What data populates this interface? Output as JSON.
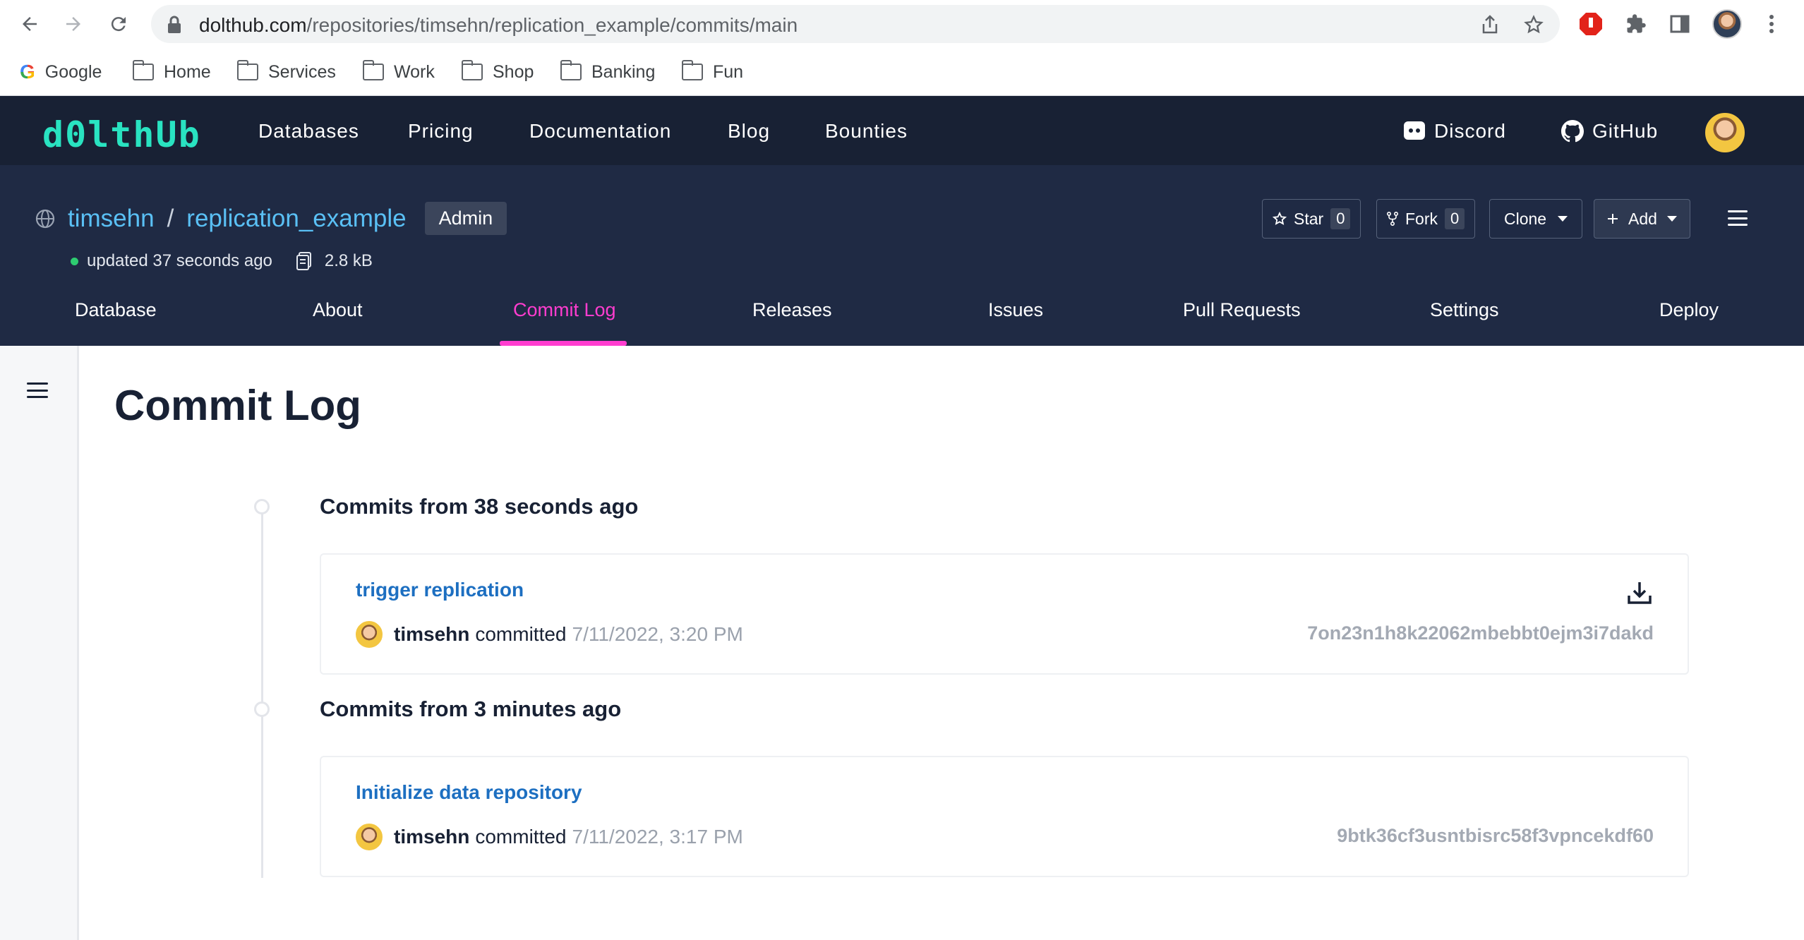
{
  "browser": {
    "url_host": "dolthub.com",
    "url_path": "/repositories/timsehn/replication_example/commits/main",
    "bookmarks": [
      {
        "label": "Google",
        "icon": "google-icon"
      },
      {
        "label": "Home",
        "icon": "folder-icon"
      },
      {
        "label": "Services",
        "icon": "folder-icon"
      },
      {
        "label": "Work",
        "icon": "folder-icon"
      },
      {
        "label": "Shop",
        "icon": "folder-icon"
      },
      {
        "label": "Banking",
        "icon": "folder-icon"
      },
      {
        "label": "Fun",
        "icon": "folder-icon"
      }
    ]
  },
  "topnav": {
    "logo": "d0lthUb",
    "links": [
      "Databases",
      "Pricing",
      "Documentation",
      "Blog",
      "Bounties"
    ],
    "discord": "Discord",
    "github": "GitHub"
  },
  "repo": {
    "owner": "timsehn",
    "separator": "/",
    "name": "replication_example",
    "badge": "Admin",
    "updated": "updated 37 seconds ago",
    "size": "2.8 kB",
    "star_label": "Star",
    "star_count": "0",
    "fork_label": "Fork",
    "fork_count": "0",
    "clone_label": "Clone",
    "add_label": "Add",
    "tabs": [
      "Database",
      "About",
      "Commit Log",
      "Releases",
      "Issues",
      "Pull Requests",
      "Settings",
      "Deploy"
    ],
    "active_tab": "Commit Log"
  },
  "page": {
    "title": "Commit Log",
    "groups": [
      {
        "heading": "Commits from 38 seconds ago",
        "commit": {
          "message": "trigger replication",
          "author": "timsehn",
          "verb": "committed",
          "date": "7/11/2022, 3:20 PM",
          "hash": "7on23n1h8k22062mbebbt0ejm3i7dakd"
        }
      },
      {
        "heading": "Commits from 3 minutes ago",
        "commit": {
          "message": "Initialize data repository",
          "author": "timsehn",
          "verb": "committed",
          "date": "7/11/2022, 3:17 PM",
          "hash": "9btk36cf3usntbisrc58f3vpncekdf60"
        }
      }
    ]
  },
  "colors": {
    "nav_bg": "#182134",
    "repo_bg": "#1f2a44",
    "accent_pink": "#ff3dcf",
    "logo_teal": "#29e3c1",
    "link_blue": "#1d6fc1"
  }
}
